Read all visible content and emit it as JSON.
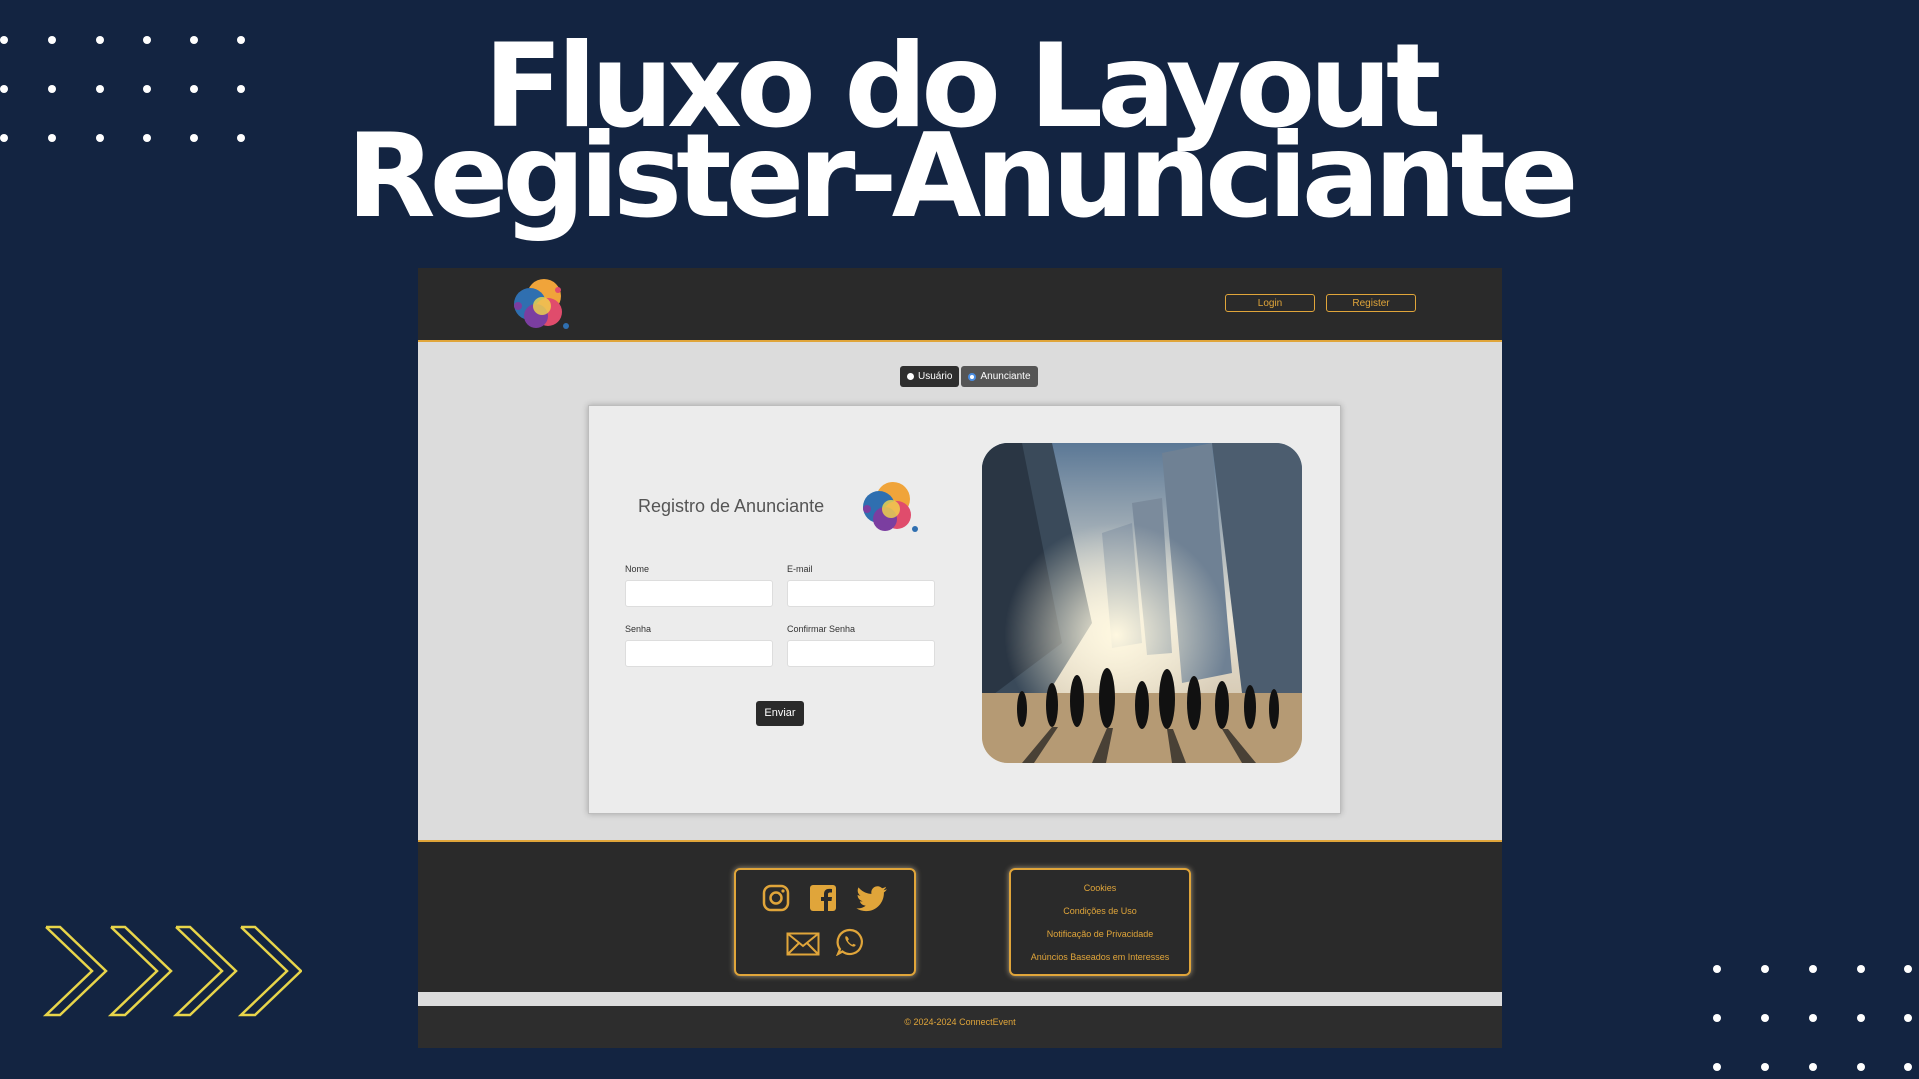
{
  "slide": {
    "title_line1": "Fluxo do Layout",
    "title_line2": "Register-Anunciante"
  },
  "colors": {
    "background": "#132441",
    "accent": "#e0a53a",
    "nav_bg": "#2a2a2a",
    "chevron": "#e8d54a"
  },
  "nav": {
    "login_label": "Login",
    "register_label": "Register",
    "logo_icon": "multicolor-bubble-logo-icon"
  },
  "toggle": {
    "user_label": "Usuário",
    "advertiser_label": "Anunciante",
    "selected": "Anunciante"
  },
  "form": {
    "title": "Registro de Anunciante",
    "name_label": "Nome",
    "email_label": "E-mail",
    "password_label": "Senha",
    "confirm_label": "Confirmar Senha",
    "submit_label": "Enviar"
  },
  "footer": {
    "social_icons": [
      "instagram-icon",
      "facebook-icon",
      "twitter-icon",
      "mail-icon",
      "whatsapp-icon"
    ],
    "links": [
      "Cookies",
      "Condições de Uso",
      "Notificação de Privacidade",
      "Anúncios Baseados em Interesses"
    ],
    "copyright": "© 2024-2024 ConnectEvent"
  }
}
